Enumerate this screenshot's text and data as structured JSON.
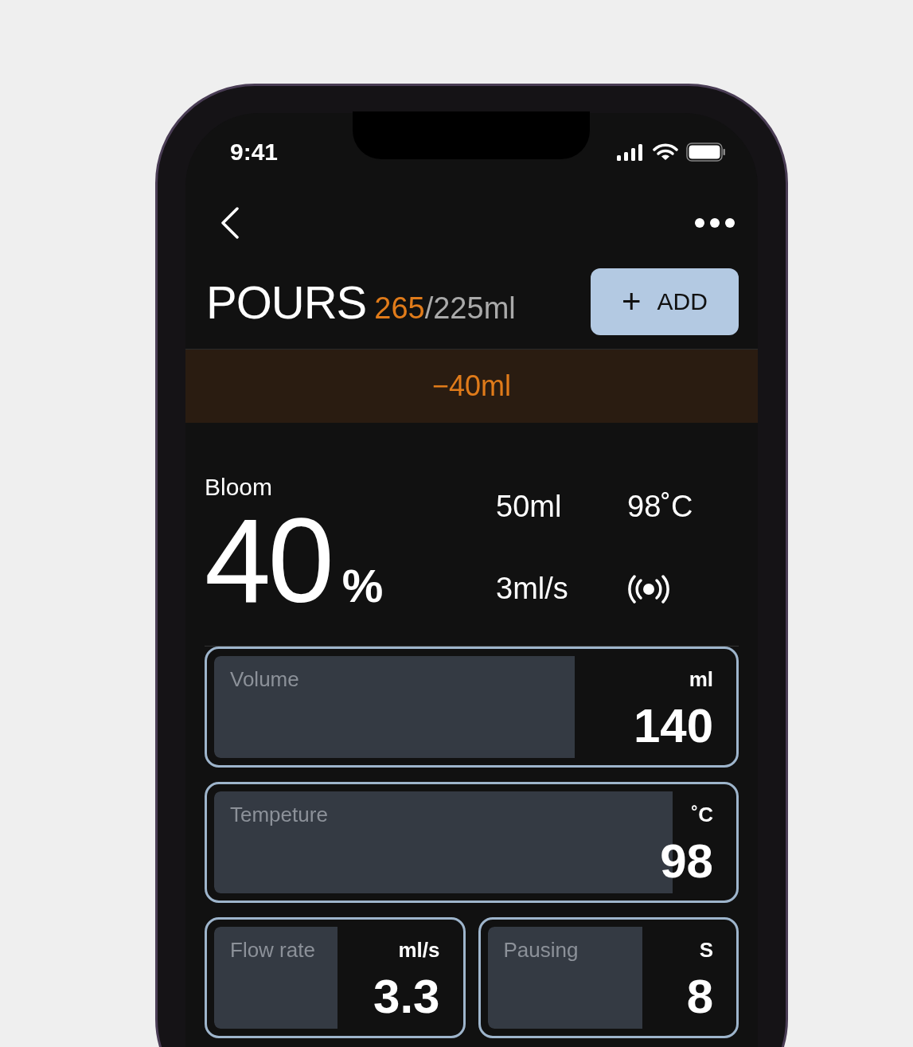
{
  "status_bar": {
    "time": "9:41"
  },
  "header": {
    "title": "POURS",
    "poured": "265",
    "target": "/225ml",
    "add_button": {
      "icon": "+",
      "label": "ADD"
    }
  },
  "banner": {
    "text": "−40ml"
  },
  "step": {
    "name": "Bloom",
    "percent": "40",
    "percent_unit": "%",
    "volume": "50ml",
    "temperature": "98˚C",
    "flow": "3ml/s"
  },
  "controls": [
    {
      "label": "Volume",
      "unit": "ml",
      "value": "140",
      "level": 0.7
    },
    {
      "label": "Tempeture",
      "unit": "˚C",
      "value": "98",
      "level": 0.89
    },
    {
      "label": "Flow rate",
      "unit": "ml/s",
      "value": "3.3",
      "level": 0.51
    },
    {
      "label": "Pausing",
      "unit": "S",
      "value": "8",
      "level": 0.64
    }
  ]
}
